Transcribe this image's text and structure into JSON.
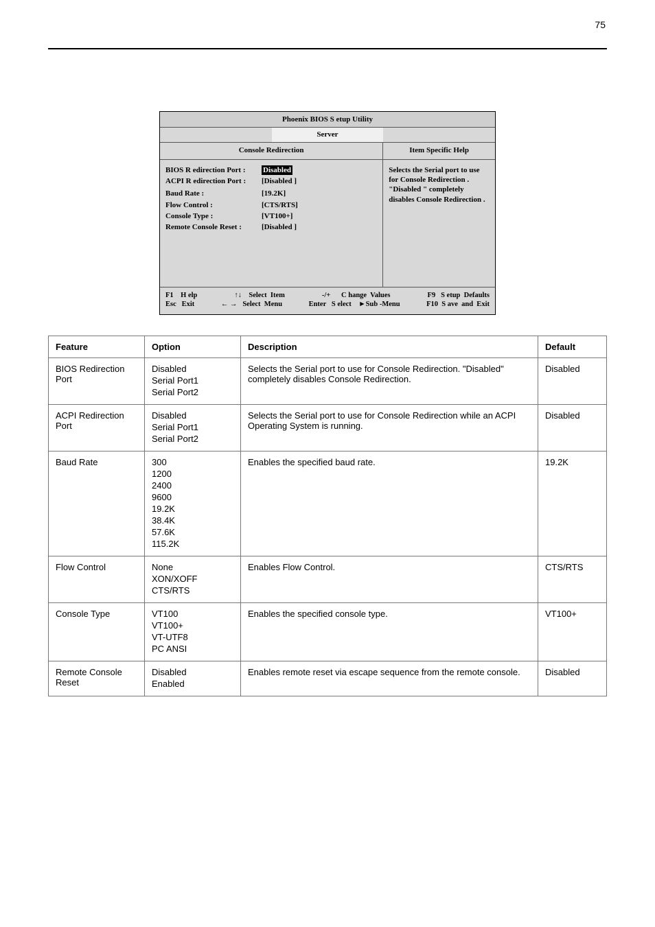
{
  "doc": {
    "header_left": "",
    "page_number": "75",
    "footer": ""
  },
  "bios": {
    "title": "Phoenix  BIOS S etup  Utility",
    "tab": "Server",
    "left_heading": "Console  Redirection",
    "right_heading": "Item Specific  Help",
    "rows": [
      {
        "label": "BIOS R edirection    Port :",
        "value": "Disabled",
        "selected": true
      },
      {
        "label": "ACPI R edirection    Port :",
        "value": "[Disabled  ]",
        "selected": false
      },
      {
        "label": "",
        "value": "",
        "selected": false
      },
      {
        "label": "Baud  Rate :",
        "value": "[19.2K]",
        "selected": false
      },
      {
        "label": "Flow  Control :",
        "value": "[CTS/RTS]",
        "selected": false
      },
      {
        "label": "Console   Type :",
        "value": "[VT100+]",
        "selected": false
      },
      {
        "label": "Remote  Console  Reset :",
        "value": "[Disabled  ]",
        "selected": false
      }
    ],
    "help_text": "Selects   the  Serial  port to  use  for  Console Redirection   . \"Disabled  \" completely disables   Console Redirection   .",
    "footer": {
      "r1c1": "F1    H elp",
      "r1c2": "↑↓    Select  Item",
      "r1c3": "-/+      C hange  Values",
      "r1c4": "F9   S etup  Defaults",
      "r2c1": "Esc   Exit",
      "r2c2": "← →   Select  Menu",
      "r2c3": "Enter   S elect    ►Sub -Menu",
      "r2c4": "F10  S ave  and  Exit"
    }
  },
  "table": {
    "headers": {
      "feature": "Feature",
      "option": "Option",
      "description": "Description",
      "default": "Default"
    },
    "rows": [
      {
        "feature": "BIOS Redirection Port",
        "options": [
          "Disabled",
          "Serial Port1",
          "Serial Port2"
        ],
        "description": "Selects the Serial port to use for Console Redirection. \"Disabled\" completely disables Console Redirection.",
        "default": "Disabled"
      },
      {
        "feature": "ACPI Redirection Port",
        "options": [
          "Disabled",
          "Serial Port1",
          "Serial Port2"
        ],
        "description": "Selects the Serial port to use for Console Redirection while an ACPI Operating System is running.",
        "default": "Disabled"
      },
      {
        "feature": "Baud Rate",
        "options": [
          "300",
          "1200",
          "2400",
          "9600",
          "19.2K",
          "38.4K",
          "57.6K",
          "115.2K"
        ],
        "description": "Enables the specified baud rate.",
        "default": "19.2K"
      },
      {
        "feature": "Flow Control",
        "options": [
          "None",
          "XON/XOFF",
          "CTS/RTS"
        ],
        "description": "Enables Flow Control.",
        "default": "CTS/RTS"
      },
      {
        "feature": "Console Type",
        "options": [
          "VT100",
          "VT100+",
          "VT-UTF8",
          "PC ANSI"
        ],
        "description": "Enables the specified console type.",
        "default": "VT100+"
      },
      {
        "feature": "Remote Console Reset",
        "options": [
          "Disabled",
          "Enabled"
        ],
        "description": "Enables remote reset via escape sequence from the remote console.",
        "default": "Disabled"
      }
    ]
  }
}
